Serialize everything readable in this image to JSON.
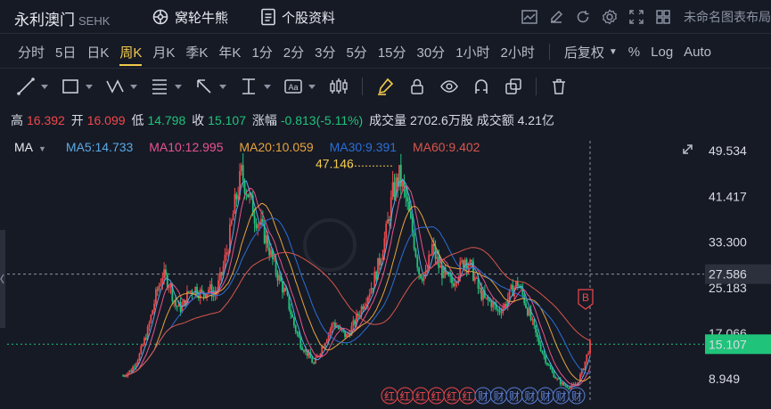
{
  "header": {
    "stock_name": "永利澳门",
    "market": "SEHK",
    "warrants_label": "窝轮牛熊",
    "profile_label": "个股资料",
    "layout_name": "未命名图表布局"
  },
  "periods": [
    "分时",
    "5日",
    "日K",
    "周K",
    "月K",
    "季K",
    "年K",
    "1分",
    "2分",
    "3分",
    "5分",
    "15分",
    "30分",
    "1小时",
    "2小时"
  ],
  "active_period": "周K",
  "right_controls": {
    "adjust": "后复权",
    "percent": "%",
    "log": "Log",
    "auto": "Auto"
  },
  "quote": {
    "high_label": "高",
    "high": "16.392",
    "open_label": "开",
    "open": "16.099",
    "low_label": "低",
    "low": "14.798",
    "close_label": "收",
    "close": "15.107",
    "change_label": "涨幅",
    "change": "-0.813(-5.11%)",
    "volume_label": "成交量",
    "volume": "2702.6万股",
    "turnover_label": "成交额",
    "turnover": "4.21亿"
  },
  "legend": {
    "ma_label": "MA",
    "ma5": "MA5:14.733",
    "ma10": "MA10:12.995",
    "ma20": "MA20:10.059",
    "ma30": "MA30:9.391",
    "ma60": "MA60:9.402"
  },
  "colors": {
    "up": "#f0484b",
    "down": "#1fc37a",
    "ma5": "#5aa9e6",
    "ma10": "#e8548d",
    "ma20": "#e8a33c",
    "ma30": "#2a6fd6",
    "ma60": "#d9564b",
    "accent": "#f2c94c"
  },
  "axis": {
    "ticks": [
      "49.534",
      "41.417",
      "33.300",
      "25.183",
      "17.066",
      "8.949"
    ],
    "crosshair_price": "27.586",
    "last_price": "15.107",
    "peak_label": "47.146"
  },
  "markers": {
    "signal": "B",
    "events": [
      "红",
      "红",
      "红",
      "红",
      "红",
      "红",
      "财",
      "财",
      "财",
      "财",
      "财",
      "财",
      "财"
    ]
  },
  "chart_data": {
    "type": "candlestick",
    "title": "",
    "ylim": [
      5.0,
      51.0
    ],
    "y_ticks": [
      49.534,
      41.417,
      33.3,
      25.183,
      17.066,
      8.949
    ],
    "weekly_close_path": [
      [
        0,
        9.5
      ],
      [
        5,
        10.5
      ],
      [
        10,
        13.2
      ],
      [
        15,
        17.5
      ],
      [
        20,
        23.8
      ],
      [
        24,
        27.5
      ],
      [
        28,
        26.0
      ],
      [
        32,
        22.0
      ],
      [
        36,
        21.5
      ],
      [
        40,
        24.5
      ],
      [
        44,
        25.0
      ],
      [
        48,
        24.0
      ],
      [
        52,
        25.0
      ],
      [
        56,
        24.0
      ],
      [
        60,
        27.5
      ],
      [
        64,
        33.0
      ],
      [
        68,
        40.0
      ],
      [
        72,
        45.5
      ],
      [
        76,
        42.0
      ],
      [
        80,
        38.0
      ],
      [
        84,
        36.0
      ],
      [
        88,
        33.0
      ],
      [
        92,
        29.0
      ],
      [
        96,
        26.0
      ],
      [
        100,
        23.0
      ],
      [
        104,
        18.5
      ],
      [
        108,
        15.2
      ],
      [
        112,
        13.5
      ],
      [
        116,
        11.5
      ],
      [
        120,
        14.0
      ],
      [
        124,
        16.5
      ],
      [
        128,
        19.0
      ],
      [
        132,
        17.5
      ],
      [
        136,
        16.5
      ],
      [
        140,
        18.5
      ],
      [
        144,
        21.0
      ],
      [
        148,
        23.5
      ],
      [
        152,
        26.0
      ],
      [
        156,
        30.0
      ],
      [
        160,
        35.0
      ],
      [
        164,
        42.0
      ],
      [
        168,
        45.0
      ],
      [
        172,
        41.0
      ],
      [
        176,
        35.0
      ],
      [
        180,
        28.0
      ],
      [
        184,
        27.0
      ],
      [
        188,
        32.5
      ],
      [
        192,
        29.0
      ],
      [
        196,
        27.0
      ],
      [
        200,
        26.0
      ],
      [
        204,
        28.0
      ],
      [
        208,
        30.5
      ],
      [
        212,
        28.5
      ],
      [
        216,
        25.0
      ],
      [
        220,
        23.0
      ],
      [
        224,
        22.5
      ],
      [
        228,
        21.0
      ],
      [
        232,
        22.0
      ],
      [
        236,
        24.5
      ],
      [
        240,
        26.0
      ],
      [
        244,
        23.0
      ],
      [
        248,
        19.5
      ],
      [
        252,
        16.0
      ],
      [
        256,
        13.0
      ],
      [
        260,
        10.5
      ],
      [
        264,
        8.8
      ],
      [
        268,
        7.8
      ],
      [
        272,
        7.5
      ],
      [
        276,
        8.0
      ],
      [
        280,
        11.0
      ],
      [
        284,
        15.1
      ]
    ],
    "peak_value": 47.146,
    "crosshair_value": 27.586,
    "last_value": 15.107
  }
}
